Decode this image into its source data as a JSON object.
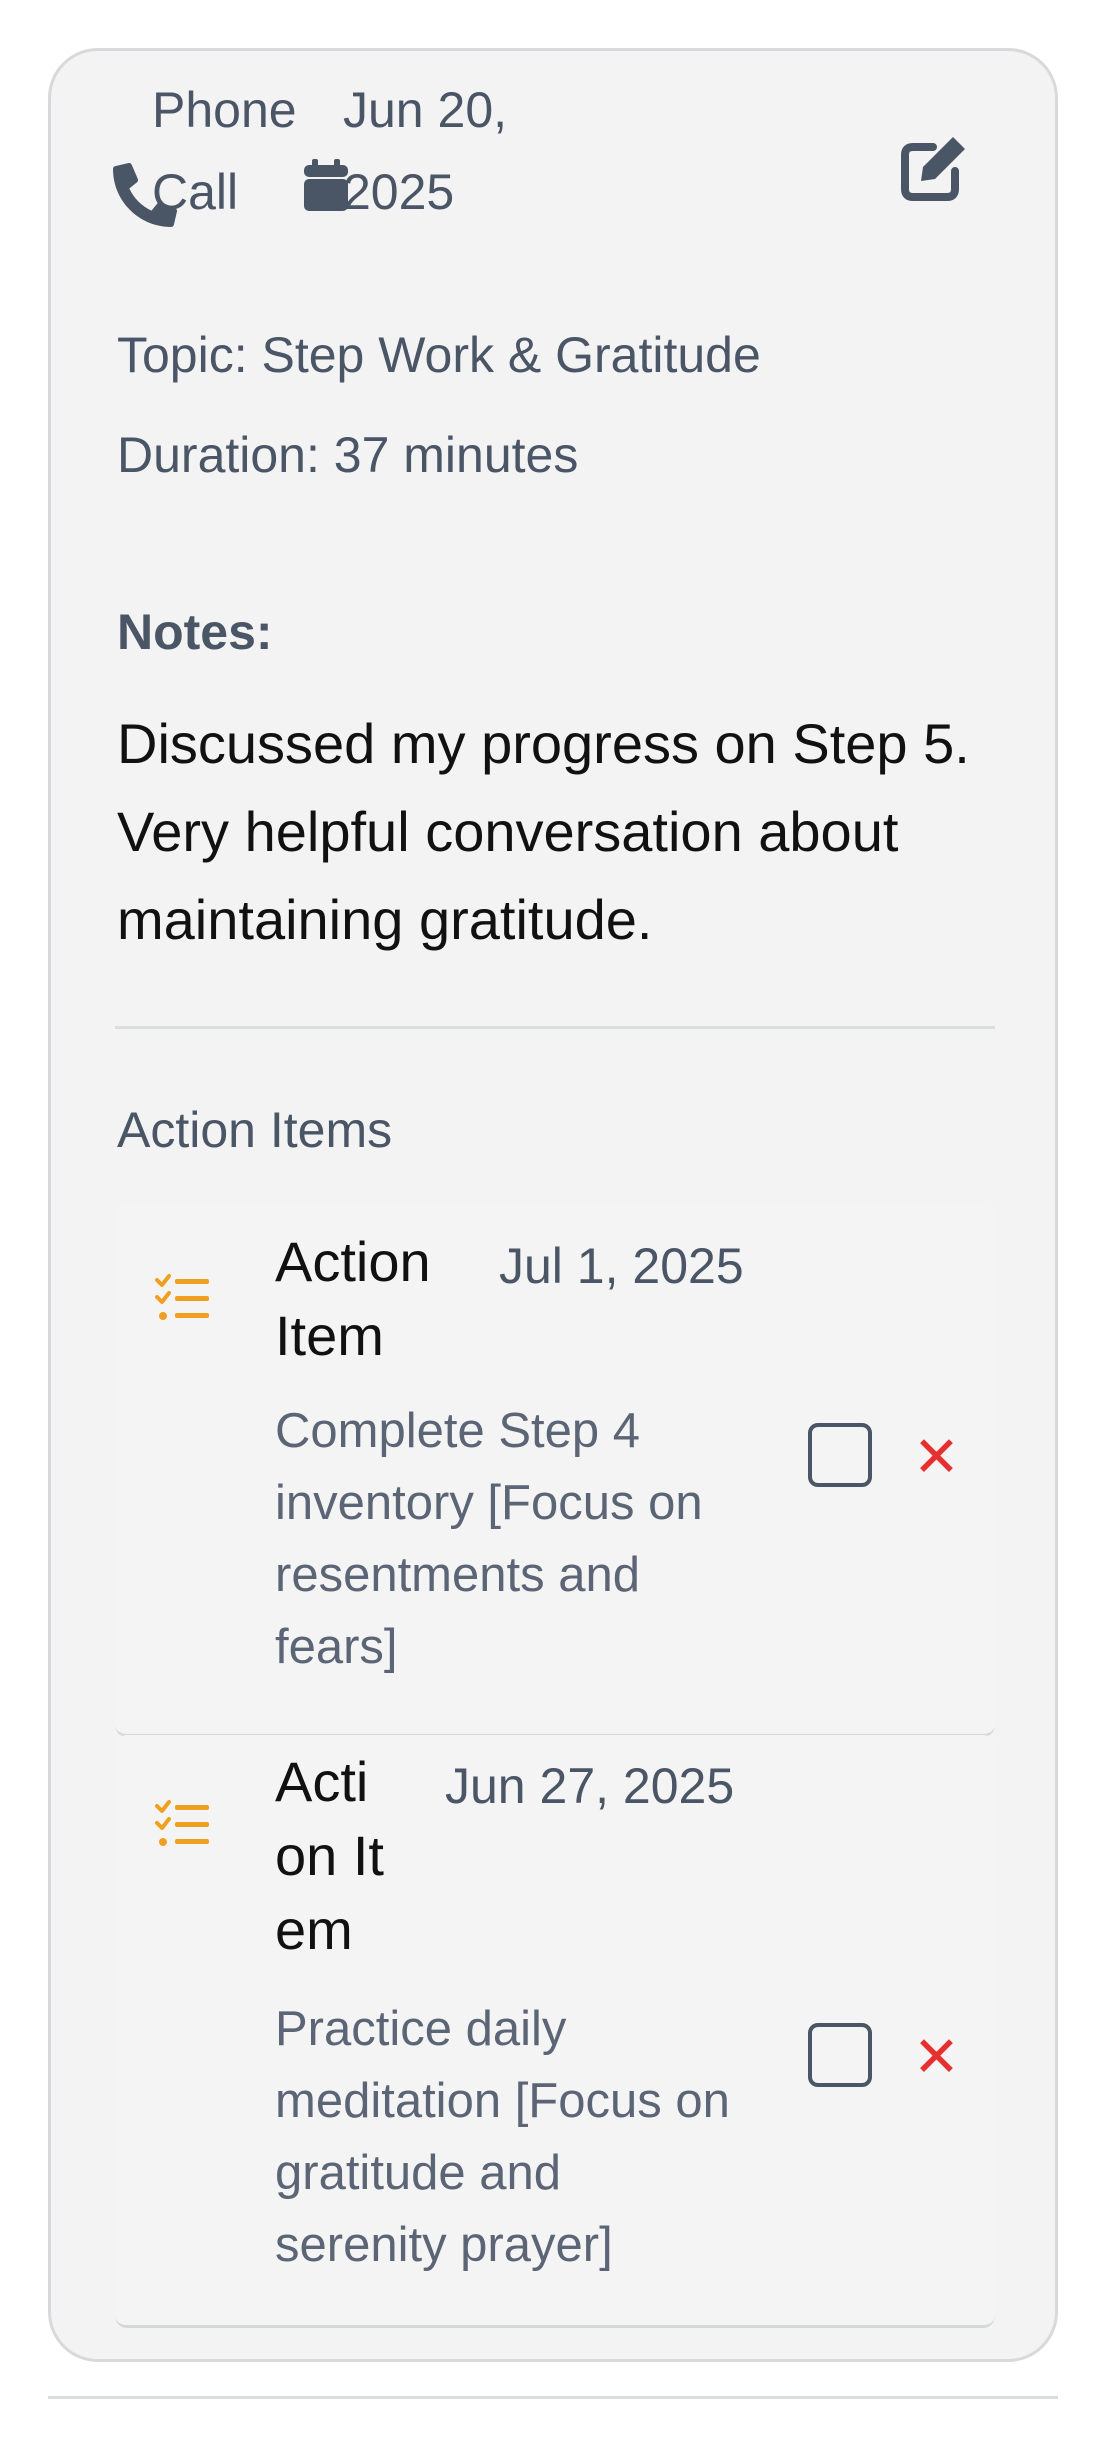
{
  "call": {
    "type": "Phone Call",
    "date": "Jun 20, 2025",
    "topic": "Topic: Step Work & Gratitude",
    "duration": "Duration: 37 minutes"
  },
  "notes": {
    "label": "Notes:",
    "text": "Discussed my progress on Step 5. Very helpful conversation about maintaining gratitude."
  },
  "action_items": {
    "label": "Action Items",
    "items": [
      {
        "title": "Action Item",
        "date": "Jul 1, 2025",
        "description": "Complete Step 4 inventory [Focus on resentments and fears]",
        "completed": false
      },
      {
        "title": "Action Item",
        "date": "Jun 27, 2025",
        "description": "Practice daily meditation [Focus on gratitude and serenity prayer]",
        "completed": false
      }
    ]
  },
  "colors": {
    "card_background": "#f3f3f4",
    "accent_orange": "#f0a020",
    "delete_red": "#e5302f",
    "muted_text": "#4a5566"
  },
  "icons": {
    "phone": "phone-icon",
    "calendar": "calendar-icon",
    "edit": "edit-icon",
    "task_list": "task-list-icon",
    "checkbox": "checkbox-icon",
    "delete": "delete-icon",
    "delete_glyph": "✕"
  }
}
